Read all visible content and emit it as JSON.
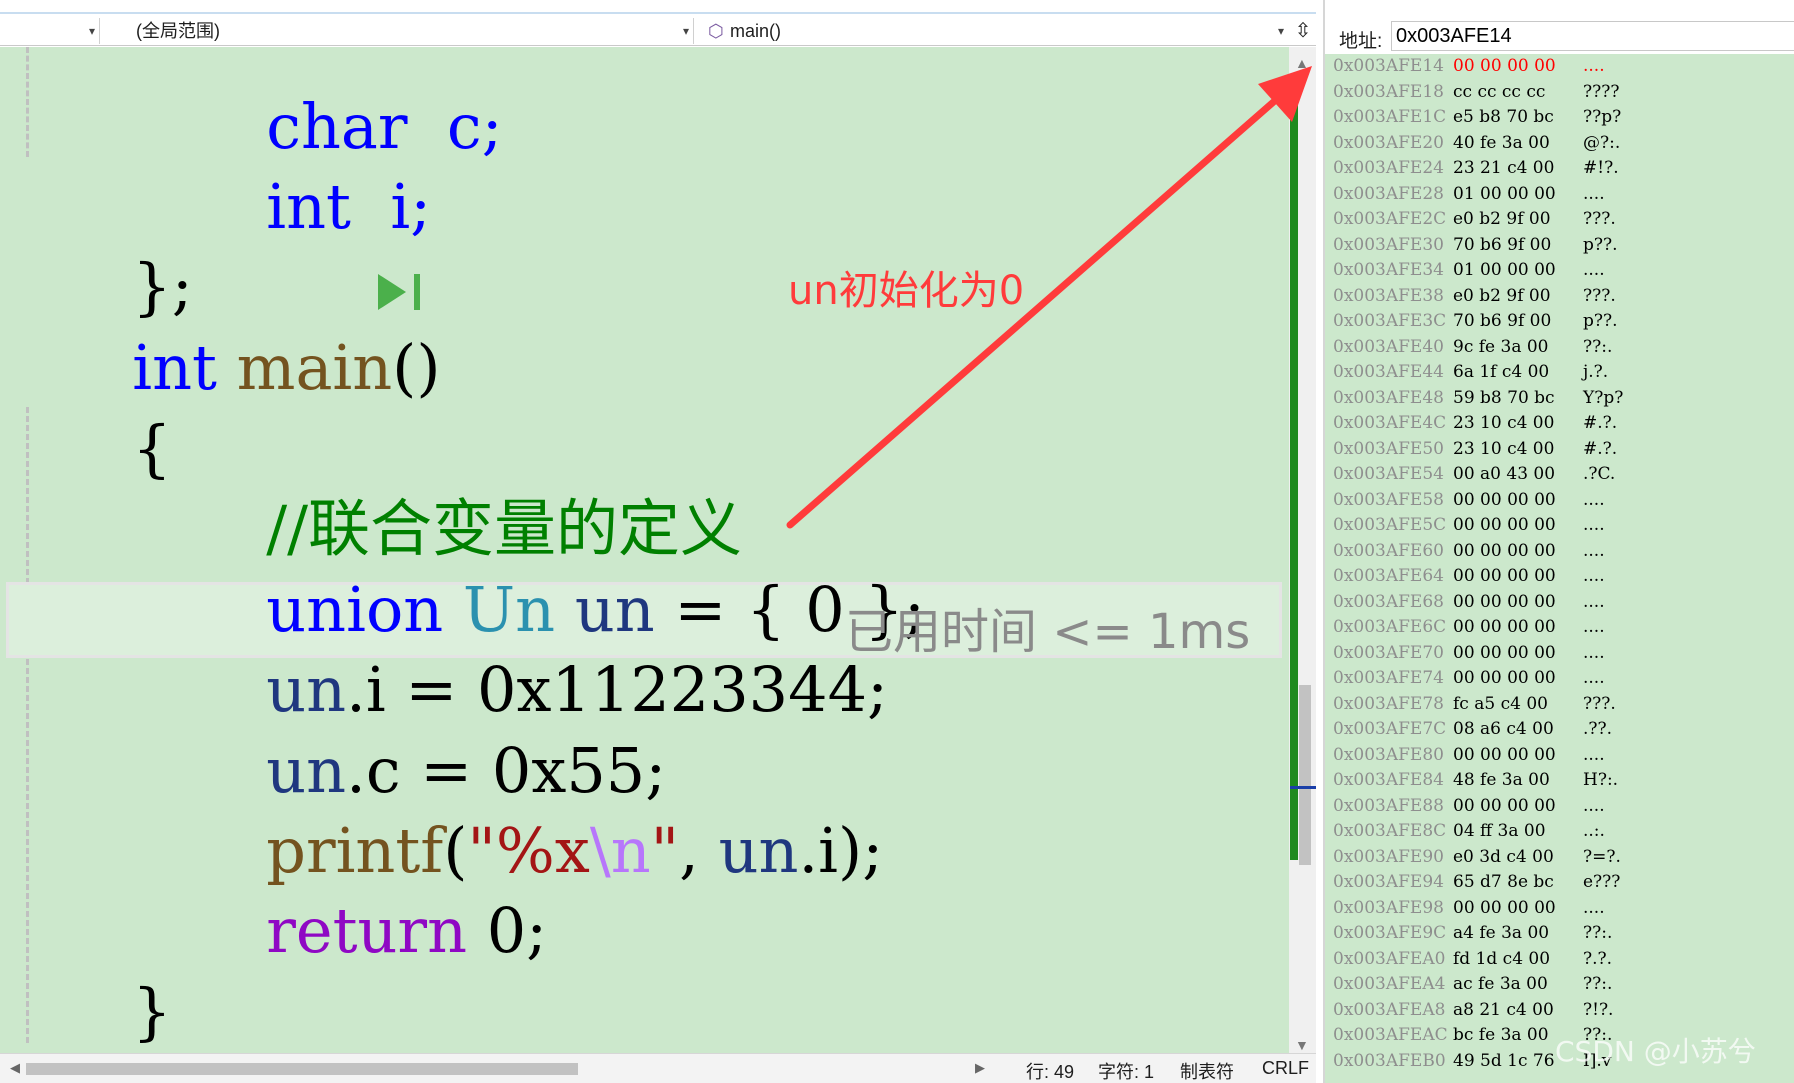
{
  "toolbar": {
    "project_dropdown": "",
    "scope_dropdown": "(全局范围)",
    "function_dropdown": "main()",
    "split_icon": "split-icon"
  },
  "code": {
    "partial_top": "char  c;",
    "l1": "int  i;",
    "l2": "};",
    "l3_kw": "int",
    "l3_fn": "main",
    "l3_rest": "()",
    "l4": "{",
    "l5_comment": "//联合变量的定义",
    "l6_kw": "union",
    "l6_ty": "Un",
    "l6_var": "un",
    "l6_rest": " = { 0 };",
    "l7_var": "un",
    "l7_rest": ".i = 0x11223344;",
    "l8_var": "un",
    "l8_rest": ".c = 0x55;",
    "l9_fn": "printf",
    "l9_open": "(",
    "l9_str1": "\"%x",
    "l9_esc": "\\n",
    "l9_str2": "\"",
    "l9_sep": ", ",
    "l9_var": "un",
    "l9_rest": ".i);",
    "l10_kw": "return",
    "l10_rest": " 0;",
    "l11": "}"
  },
  "perf_tip": "已用时间 <= 1ms",
  "annotation": "un初始化为0",
  "colors": {
    "editor_bg": "#cce8cc",
    "keyword": "#0000ff",
    "type": "#2b91af",
    "annotation": "#ff3b3b",
    "changed_memory": "#ff0000"
  },
  "status": {
    "line": "行: 49",
    "char": "字符: 1",
    "tabs": "制表符",
    "eol": "CRLF"
  },
  "memory": {
    "address_label": "地址:",
    "address_value": "0x003AFE14",
    "rows": [
      {
        "addr": "0x003AFE14",
        "hex": "00 00 00 00",
        "ascii": "....",
        "changed": true
      },
      {
        "addr": "0x003AFE18",
        "hex": "cc cc cc cc",
        "ascii": "????",
        "changed": false
      },
      {
        "addr": "0x003AFE1C",
        "hex": "e5 b8 70 bc",
        "ascii": "??p?",
        "changed": false
      },
      {
        "addr": "0x003AFE20",
        "hex": "40 fe 3a 00",
        "ascii": "@?:.",
        "changed": false
      },
      {
        "addr": "0x003AFE24",
        "hex": "23 21 c4 00",
        "ascii": "#!?.",
        "changed": false
      },
      {
        "addr": "0x003AFE28",
        "hex": "01 00 00 00",
        "ascii": "....",
        "changed": false
      },
      {
        "addr": "0x003AFE2C",
        "hex": "e0 b2 9f 00",
        "ascii": "???.",
        "changed": false
      },
      {
        "addr": "0x003AFE30",
        "hex": "70 b6 9f 00",
        "ascii": "p??.",
        "changed": false
      },
      {
        "addr": "0x003AFE34",
        "hex": "01 00 00 00",
        "ascii": "....",
        "changed": false
      },
      {
        "addr": "0x003AFE38",
        "hex": "e0 b2 9f 00",
        "ascii": "???.",
        "changed": false
      },
      {
        "addr": "0x003AFE3C",
        "hex": "70 b6 9f 00",
        "ascii": "p??.",
        "changed": false
      },
      {
        "addr": "0x003AFE40",
        "hex": "9c fe 3a 00",
        "ascii": "??:.",
        "changed": false
      },
      {
        "addr": "0x003AFE44",
        "hex": "6a 1f c4 00",
        "ascii": "j.?.",
        "changed": false
      },
      {
        "addr": "0x003AFE48",
        "hex": "59 b8 70 bc",
        "ascii": "Y?p?",
        "changed": false
      },
      {
        "addr": "0x003AFE4C",
        "hex": "23 10 c4 00",
        "ascii": "#.?.",
        "changed": false
      },
      {
        "addr": "0x003AFE50",
        "hex": "23 10 c4 00",
        "ascii": "#.?.",
        "changed": false
      },
      {
        "addr": "0x003AFE54",
        "hex": "00 a0 43 00",
        "ascii": ".?C.",
        "changed": false
      },
      {
        "addr": "0x003AFE58",
        "hex": "00 00 00 00",
        "ascii": "....",
        "changed": false
      },
      {
        "addr": "0x003AFE5C",
        "hex": "00 00 00 00",
        "ascii": "....",
        "changed": false
      },
      {
        "addr": "0x003AFE60",
        "hex": "00 00 00 00",
        "ascii": "....",
        "changed": false
      },
      {
        "addr": "0x003AFE64",
        "hex": "00 00 00 00",
        "ascii": "....",
        "changed": false
      },
      {
        "addr": "0x003AFE68",
        "hex": "00 00 00 00",
        "ascii": "....",
        "changed": false
      },
      {
        "addr": "0x003AFE6C",
        "hex": "00 00 00 00",
        "ascii": "....",
        "changed": false
      },
      {
        "addr": "0x003AFE70",
        "hex": "00 00 00 00",
        "ascii": "....",
        "changed": false
      },
      {
        "addr": "0x003AFE74",
        "hex": "00 00 00 00",
        "ascii": "....",
        "changed": false
      },
      {
        "addr": "0x003AFE78",
        "hex": "fc a5 c4 00",
        "ascii": "???.",
        "changed": false
      },
      {
        "addr": "0x003AFE7C",
        "hex": "08 a6 c4 00",
        "ascii": ".??.",
        "changed": false
      },
      {
        "addr": "0x003AFE80",
        "hex": "00 00 00 00",
        "ascii": "....",
        "changed": false
      },
      {
        "addr": "0x003AFE84",
        "hex": "48 fe 3a 00",
        "ascii": "H?:.",
        "changed": false
      },
      {
        "addr": "0x003AFE88",
        "hex": "00 00 00 00",
        "ascii": "....",
        "changed": false
      },
      {
        "addr": "0x003AFE8C",
        "hex": "04 ff 3a 00",
        "ascii": "..:.",
        "changed": false
      },
      {
        "addr": "0x003AFE90",
        "hex": "e0 3d c4 00",
        "ascii": "?=?.",
        "changed": false
      },
      {
        "addr": "0x003AFE94",
        "hex": "65 d7 8e bc",
        "ascii": "e???",
        "changed": false
      },
      {
        "addr": "0x003AFE98",
        "hex": "00 00 00 00",
        "ascii": "....",
        "changed": false
      },
      {
        "addr": "0x003AFE9C",
        "hex": "a4 fe 3a 00",
        "ascii": "??:.",
        "changed": false
      },
      {
        "addr": "0x003AFEA0",
        "hex": "fd 1d c4 00",
        "ascii": "?.?.",
        "changed": false
      },
      {
        "addr": "0x003AFEA4",
        "hex": "ac fe 3a 00",
        "ascii": "??:.",
        "changed": false
      },
      {
        "addr": "0x003AFEA8",
        "hex": "a8 21 c4 00",
        "ascii": "?!?.",
        "changed": false
      },
      {
        "addr": "0x003AFEAC",
        "hex": "bc fe 3a 00",
        "ascii": "??:.",
        "changed": false
      },
      {
        "addr": "0x003AFEB0",
        "hex": "49 5d 1c 76",
        "ascii": "I].v",
        "changed": false
      }
    ]
  },
  "watermark": "CSDN @小苏兮"
}
